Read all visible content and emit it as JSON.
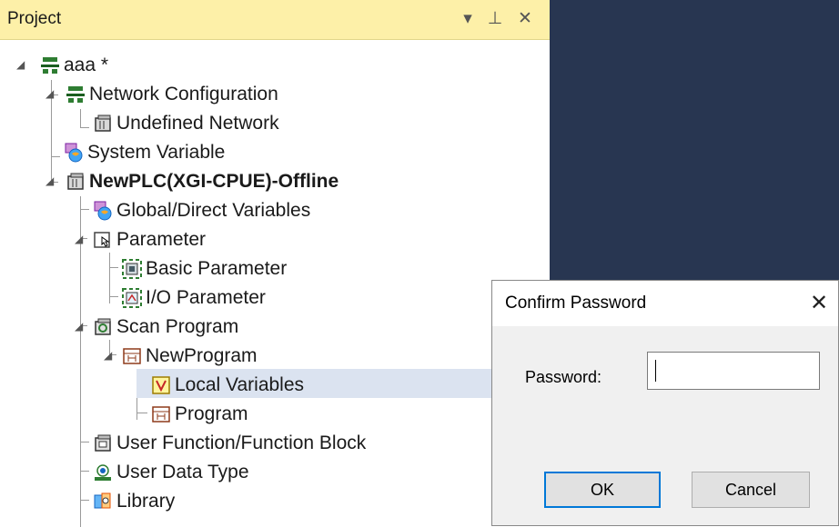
{
  "panel": {
    "title": "Project",
    "controls": {
      "dropdown": "▾",
      "pin": "⊥",
      "close": "✕"
    }
  },
  "tree": {
    "root": {
      "label": "aaa *",
      "icon": "network-icon"
    },
    "network_config": {
      "label": "Network Configuration",
      "icon": "network-icon"
    },
    "undefined_network": {
      "label": "Undefined Network",
      "icon": "plc-icon"
    },
    "system_variable": {
      "label": "System Variable",
      "icon": "variable-icon"
    },
    "plc": {
      "label": "NewPLC(XGI-CPUE)-Offline",
      "icon": "plc-icon"
    },
    "global_vars": {
      "label": "Global/Direct Variables",
      "icon": "variable-icon"
    },
    "parameter": {
      "label": "Parameter",
      "icon": "parameter-icon"
    },
    "basic_param": {
      "label": "Basic Parameter",
      "icon": "basic-parameter-icon"
    },
    "io_param": {
      "label": "I/O Parameter",
      "icon": "io-parameter-icon"
    },
    "scan_program": {
      "label": "Scan Program",
      "icon": "scan-program-icon"
    },
    "new_program": {
      "label": "NewProgram",
      "icon": "program-icon"
    },
    "local_vars": {
      "label": "Local Variables",
      "icon": "local-variables-icon"
    },
    "program": {
      "label": "Program",
      "icon": "program-icon"
    },
    "user_function": {
      "label": "User Function/Function Block",
      "icon": "function-block-icon"
    },
    "user_data_type": {
      "label": "User Data Type",
      "icon": "data-type-icon"
    },
    "library": {
      "label": "Library",
      "icon": "library-icon"
    }
  },
  "dialog": {
    "title": "Confirm Password",
    "close": "✕",
    "password_label": "Password:",
    "password_value": "",
    "ok_label": "OK",
    "cancel_label": "Cancel"
  },
  "colors": {
    "header_bg": "#fdf0a8",
    "right_bg": "#283651",
    "selection_bg": "#dbe3f0",
    "ok_border": "#0078d7"
  }
}
